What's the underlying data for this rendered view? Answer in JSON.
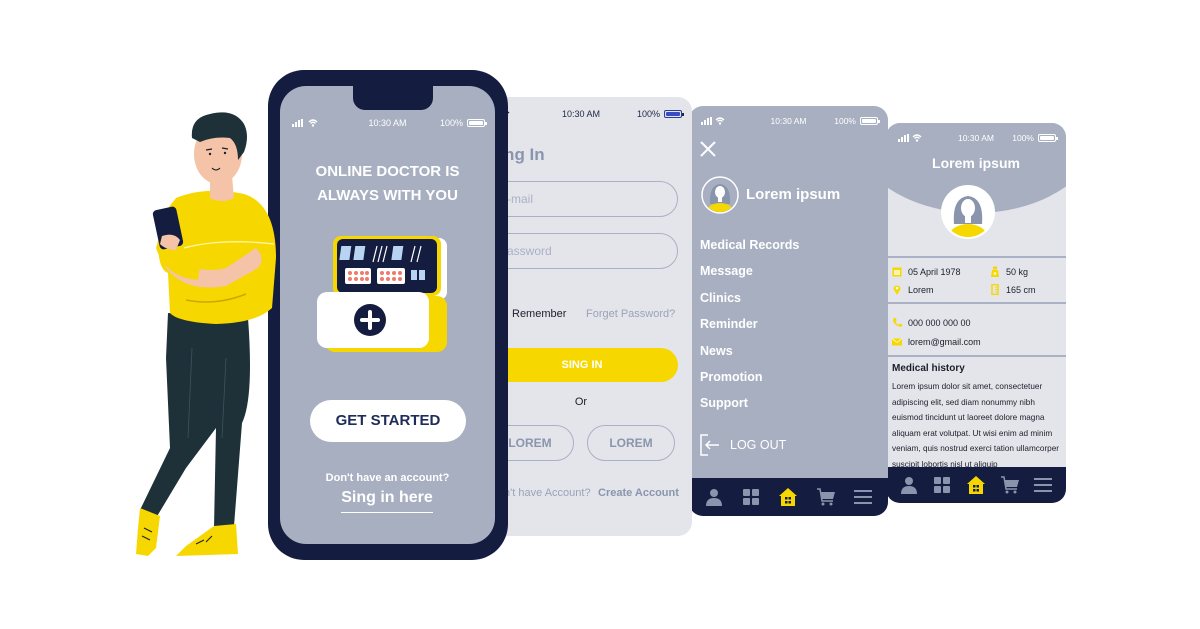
{
  "status_bar": {
    "time": "10:30 AM",
    "battery": "100%"
  },
  "welcome_screen": {
    "title_line1": "ONLINE DOCTOR IS",
    "title_line2": "ALWAYS WITH YOU",
    "get_started": "GET STARTED",
    "no_account": "Don't have an account?",
    "sign_in_link": "Sing in here"
  },
  "signin_screen": {
    "title": "Sing In",
    "email_placeholder": "E-mail",
    "password_placeholder": "Password",
    "remember": "Remember",
    "forget_password": "Forget Password?",
    "signin_button": "SING IN",
    "or": "Or",
    "social_buttons": [
      "LOREM",
      "LOREM"
    ],
    "no_account": "Don't have Account?",
    "create_account": "Create Account"
  },
  "menu_screen": {
    "user_name": "Lorem ipsum",
    "items": [
      "Medical Records",
      "Message",
      "Clinics",
      "Reminder",
      "News",
      "Promotion",
      "Support"
    ],
    "logout": "LOG OUT"
  },
  "profile_screen": {
    "name": "Lorem ipsum",
    "birth_date": "05 April 1978",
    "weight": "50 kg",
    "location": "Lorem",
    "height": "165 cm",
    "phone": "000 000 000 00",
    "email": "lorem@gmail.com",
    "history_title": "Medical history",
    "history_text": "Lorem ipsum dolor sit amet, consectetuer adipiscing elit, sed diam nonummy nibh euismod tincidunt ut laoreet dolore magna aliquam erat volutpat. Ut wisi enim ad minim veniam, quis nostrud exerci tation ullamcorper suscipit lobortis nisl ut aliquip"
  },
  "bottom_nav": [
    "profile",
    "apps",
    "home",
    "cart",
    "menu"
  ],
  "colors": {
    "navy": "#141c3f",
    "slate": "#a7afc1",
    "light": "#e4e5ea",
    "accent": "#f7d700"
  }
}
